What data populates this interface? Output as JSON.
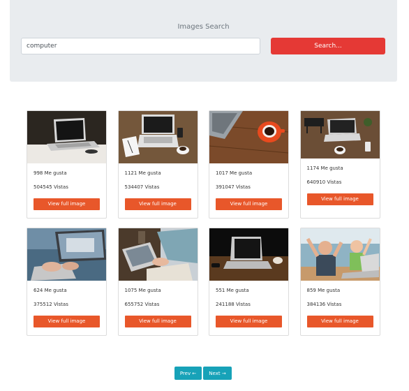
{
  "search": {
    "title": "Images Search",
    "input_value": "computer",
    "button_label": "Search..."
  },
  "results": [
    {
      "likes": "998 Me gusta",
      "views": "504545 Vistas",
      "button": "View full image",
      "image": "laptop on white desk"
    },
    {
      "likes": "1121 Me gusta",
      "views": "534407 Vistas",
      "button": "View full image",
      "image": "laptop with notebook and coffee"
    },
    {
      "likes": "1017 Me gusta",
      "views": "391047 Vistas",
      "button": "View full image",
      "image": "laptop corner with red coffee cup"
    },
    {
      "likes": "1174 Me gusta",
      "views": "640910 Vistas",
      "button": "View full image",
      "image": "desk with laptop, dream sign and coffee"
    },
    {
      "likes": "624 Me gusta",
      "views": "375512 Vistas",
      "button": "View full image",
      "image": "hands typing on laptop"
    },
    {
      "likes": "1075 Me gusta",
      "views": "655752 Vistas",
      "button": "View full image",
      "image": "person working on laptop"
    },
    {
      "likes": "551 Me gusta",
      "views": "241188 Vistas",
      "button": "View full image",
      "image": "laptop on dark wooden table"
    },
    {
      "likes": "859 Me gusta",
      "views": "384136 Vistas",
      "button": "View full image",
      "image": "excited kids with laptop"
    }
  ],
  "pagination": {
    "prev_label": "Prev ←",
    "next_label": "Next →"
  },
  "colors": {
    "panel_bg": "#e9ecef",
    "search_button": "#e53935",
    "view_button": "#e8572a",
    "pager_button": "#17a2b8"
  }
}
